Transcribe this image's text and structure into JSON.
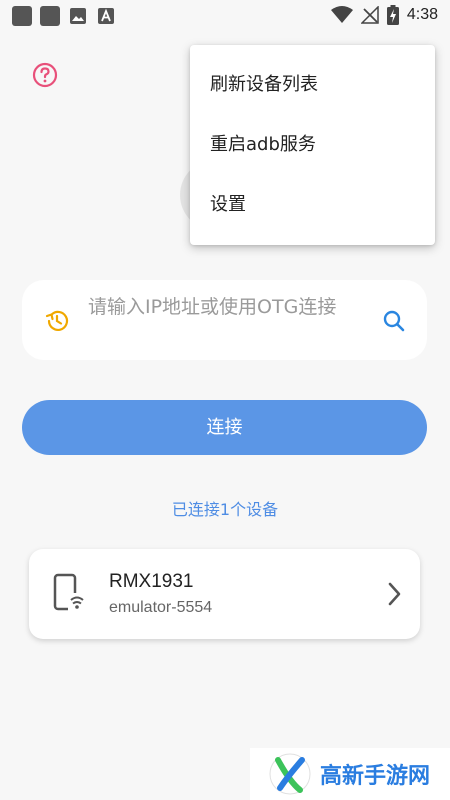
{
  "status_bar": {
    "time": "4:38",
    "icons": [
      "notification-square-icon",
      "notification-square-icon",
      "image-icon",
      "a-icon",
      "wifi-icon",
      "no-signal-icon",
      "battery-charging-icon"
    ]
  },
  "menu": {
    "items": [
      {
        "label": "刷新设备列表"
      },
      {
        "label": "重启adb服务"
      },
      {
        "label": "设置"
      }
    ]
  },
  "search": {
    "placeholder": "请输入IP地址或使用OTG连接"
  },
  "connect_button": {
    "label": "连接"
  },
  "connected_count": "已连接1个设备",
  "devices": [
    {
      "name": "RMX1931",
      "id": "emulator-5554"
    }
  ],
  "watermark": {
    "text": "高新手游网"
  },
  "colors": {
    "accent": "#5b96e6",
    "link": "#4f8de4",
    "help": "#e8507a",
    "history": "#f0a800",
    "search": "#2a86e0"
  }
}
